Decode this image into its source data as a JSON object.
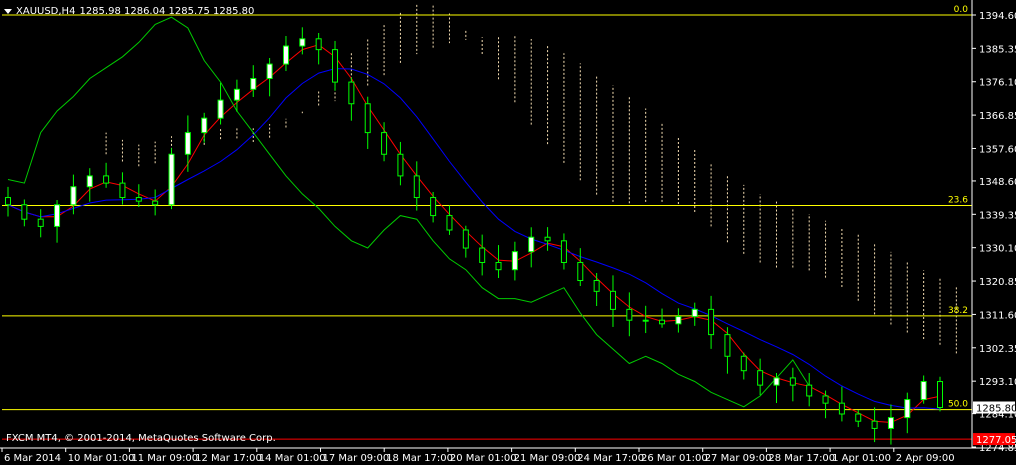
{
  "header": {
    "symbol": "XAUUSD,H4",
    "ohlc": "1285.98 1286.04 1285.75 1285.80"
  },
  "footer": {
    "copyright": "FXCM MT4, © 2001-2014, MetaQuotes Software Corp."
  },
  "colors": {
    "background": "#000000",
    "candle_bull": "#ffffff",
    "candle_bear": "#000000",
    "candle_outline": "#00ff00",
    "tenkan": "#ff0000",
    "kijun": "#0000ff",
    "chikou": "#00cc00",
    "cloud": "#f5deb3",
    "fibo": "#ffff00",
    "bid_line": "#ff0000"
  },
  "price_axis": {
    "ticks": [
      "1394.60",
      "1385.35",
      "1376.10",
      "1366.85",
      "1357.60",
      "1348.60",
      "1339.35",
      "1330.10",
      "1320.85",
      "1311.60",
      "1302.35",
      "1293.10",
      "1284.10",
      "1274.85"
    ],
    "current_price": "1285.80",
    "bid_price": "1277.05"
  },
  "fibonacci": {
    "levels": [
      {
        "label": "0.0",
        "price": 1394.6
      },
      {
        "label": "23.6",
        "price": 1341.8
      },
      {
        "label": "38.2",
        "price": 1311.2
      },
      {
        "label": "50.0",
        "price": 1285.2
      }
    ]
  },
  "time_axis": {
    "labels": [
      "6 Mar 2014",
      "10 Mar 01:00",
      "11 Mar 09:00",
      "12 Mar 17:00",
      "14 Mar 01:00",
      "17 Mar 09:00",
      "18 Mar 17:00",
      "20 Mar 01:00",
      "21 Mar 09:00",
      "24 Mar 17:00",
      "26 Mar 01:00",
      "27 Mar 09:00",
      "28 Mar 17:00",
      "1 Apr 01:00",
      "2 Apr 09:00"
    ]
  },
  "chart_data": {
    "type": "candlestick",
    "title": "XAUUSD,H4",
    "indicators": [
      "Ichimoku Kinko Hyo",
      "Fibonacci retracement"
    ],
    "ylim": [
      1274.85,
      1394.6
    ],
    "close_prices_approx": [
      1342,
      1338,
      1336,
      1342,
      1347,
      1350,
      1348,
      1344,
      1343,
      1342,
      1356,
      1362,
      1366,
      1371,
      1374,
      1377,
      1381,
      1386,
      1388,
      1385,
      1376,
      1370,
      1362,
      1356,
      1350,
      1344,
      1339,
      1335,
      1330,
      1326,
      1324,
      1329,
      1333,
      1332,
      1326,
      1321,
      1318,
      1313,
      1310,
      1310,
      1309,
      1311,
      1313,
      1306,
      1300,
      1296,
      1292,
      1294,
      1292,
      1289,
      1287,
      1284,
      1282,
      1280,
      1283,
      1288,
      1293,
      1285.8
    ]
  }
}
